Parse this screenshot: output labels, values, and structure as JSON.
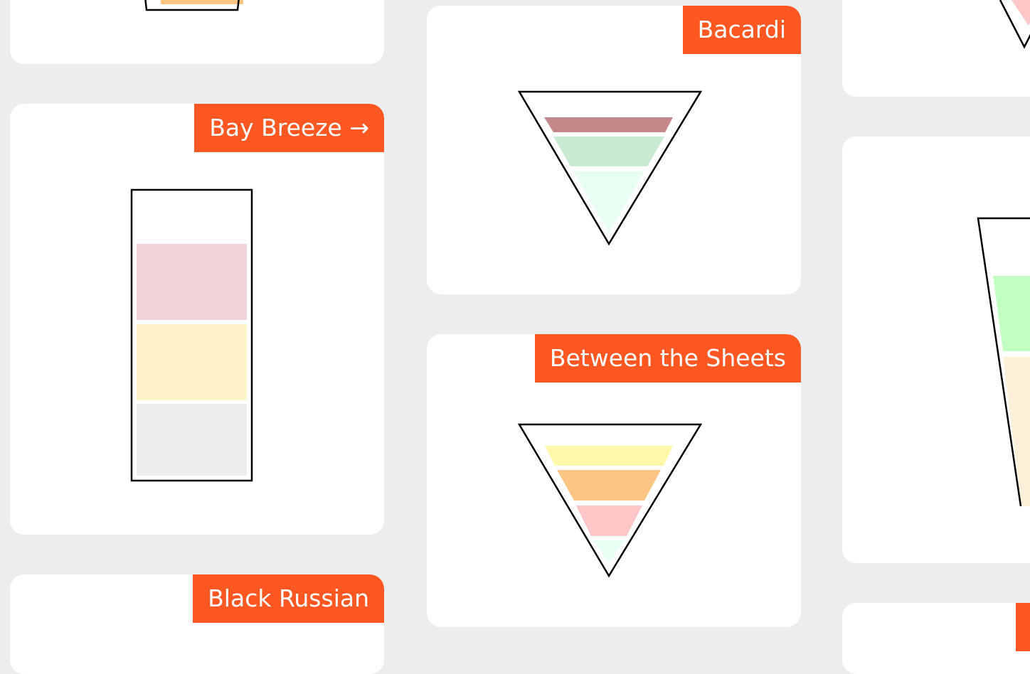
{
  "cards": {
    "bay_breeze": {
      "label": "Bay Breeze →"
    },
    "bacardi": {
      "label": "Bacardi"
    },
    "between_the_sheets": {
      "label": "Between the Sheets"
    },
    "black_russian": {
      "label": "Black Russian"
    }
  },
  "colors": {
    "page_background": "#ededed",
    "card_background": "#ffffff",
    "label_background": "#ff5722",
    "label_text": "#ffffff",
    "glass_outline": "#000000",
    "layer_pink": "#efd3d6",
    "layer_cream": "#fff4c9",
    "layer_grey": "#eeedeb",
    "layer_mauve": "#c4888a",
    "layer_mint": "#c9e9d1",
    "layer_pale_mint": "#eafff4",
    "layer_yellow": "#fff8aa",
    "layer_orange": "#fdc584",
    "layer_rose": "#ffc6c7",
    "layer_green": "#c2ffc2",
    "layer_peach": "#fdf0d9"
  }
}
